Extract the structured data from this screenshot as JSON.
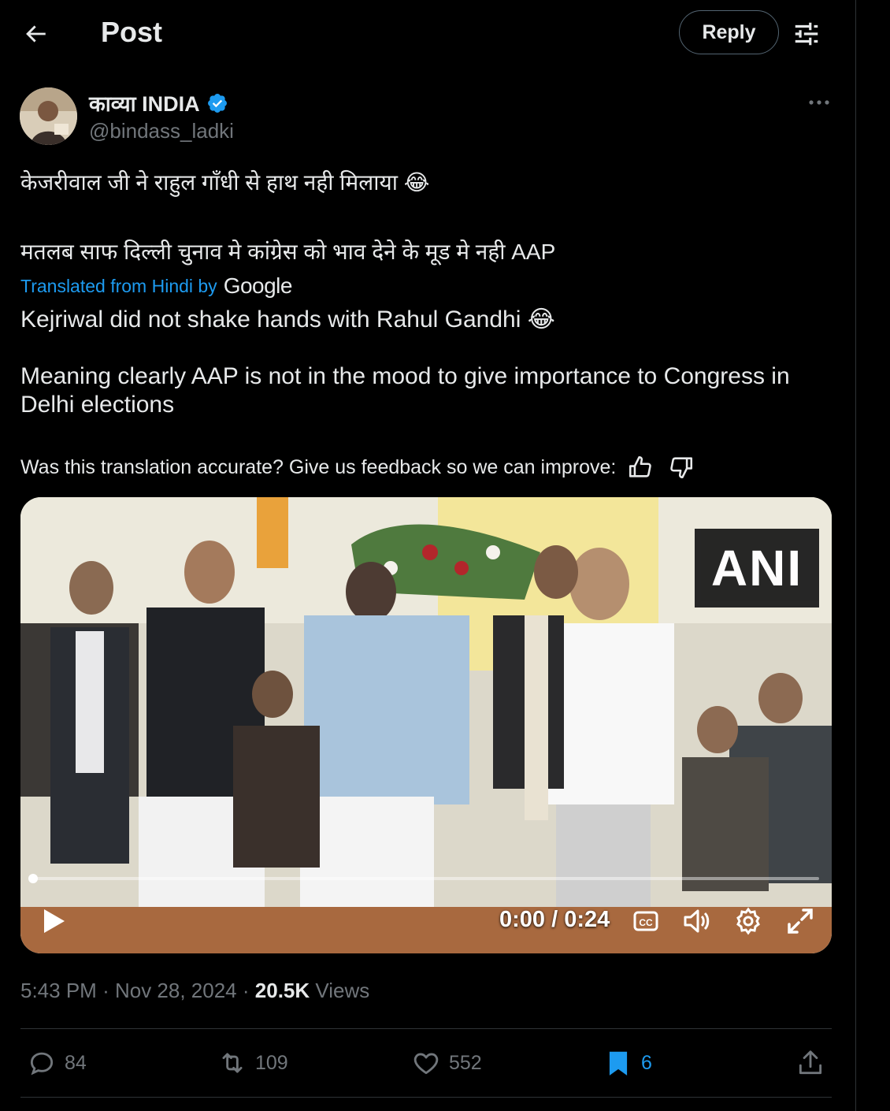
{
  "header": {
    "title": "Post",
    "reply_label": "Reply"
  },
  "author": {
    "display_name": "काव्या INDIA",
    "handle": "@bindass_ladki",
    "verified": true
  },
  "post": {
    "original_line1": "केजरीवाल जी ने राहुल गाँधी से हाथ नही मिलाया 😂",
    "original_line2": "मतलब साफ दिल्ली चुनाव मे कांग्रेस को भाव देने के मूड मे नही AAP",
    "translated_label": "Translated from Hindi by",
    "translated_provider": "Google",
    "translated_line1": "Kejriwal did not shake hands with Rahul Gandhi 😂",
    "translated_line2": "Meaning clearly AAP is not in the mood to give importance to Congress in Delhi elections",
    "feedback_prompt": "Was this translation accurate? Give us feedback so we can improve:"
  },
  "video": {
    "watermark": "ANI",
    "time_display": "0:00 / 0:24",
    "progress": 0.0
  },
  "meta": {
    "time": "5:43 PM",
    "sep1": "·",
    "date": "Nov 28, 2024",
    "sep2": "·",
    "views_count": "20.5K",
    "views_label": "Views"
  },
  "actions": {
    "replies": "84",
    "reposts": "109",
    "likes": "552",
    "bookmarks": "6"
  },
  "colors": {
    "accent": "#1d9bf0",
    "text": "#e7e9ea",
    "muted": "#71767b",
    "border": "#2f3336",
    "background": "#000000"
  }
}
